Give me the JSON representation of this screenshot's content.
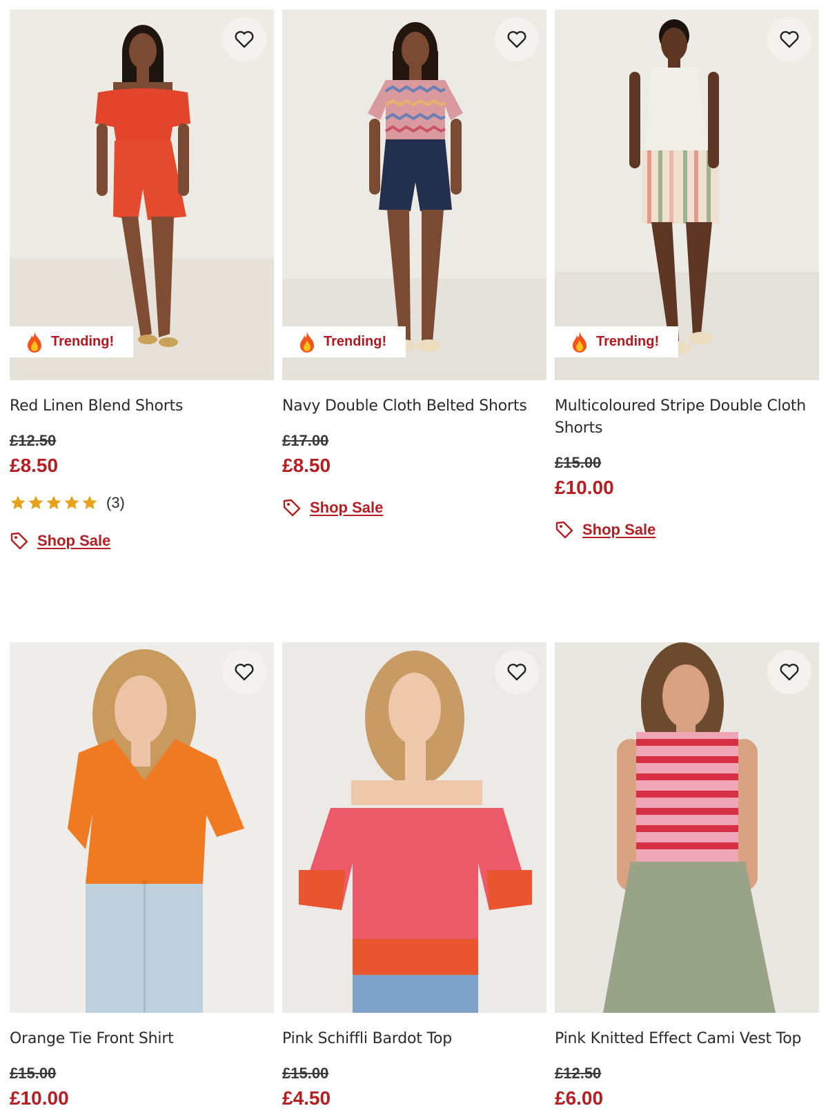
{
  "colors": {
    "accent": "#b61e22",
    "star": "#e8a21a",
    "wishlist_bg": "#f4f2ee"
  },
  "products": [
    {
      "title": "Red Linen Blend Shorts",
      "was_price": "£12.50",
      "price": "£8.50",
      "badge": "Trending!",
      "rating": {
        "stars": 5,
        "count": "(3)"
      },
      "cta": "Shop Sale",
      "image": "model-red-bardot-playsuit"
    },
    {
      "title": "Navy Double Cloth Belted Shorts",
      "was_price": "£17.00",
      "price": "£8.50",
      "badge": "Trending!",
      "cta": "Shop Sale",
      "image": "model-navy-shorts-zigzag-tee"
    },
    {
      "title": "Multicoloured Stripe Double Cloth Shorts",
      "was_price": "£15.00",
      "price": "£10.00",
      "badge": "Trending!",
      "cta": "Shop Sale",
      "image": "model-stripe-shorts-white-vest"
    },
    {
      "title": "Orange Tie Front Shirt",
      "was_price": "£15.00",
      "price": "£10.00",
      "image": "model-orange-tie-shirt"
    },
    {
      "title": "Pink Schiffli Bardot Top",
      "was_price": "£15.00",
      "price": "£4.50",
      "image": "model-pink-bardot-top"
    },
    {
      "title": "Pink Knitted Effect Cami Vest Top",
      "was_price": "£12.50",
      "price": "£6.00",
      "image": "model-pink-stripe-cami"
    }
  ]
}
